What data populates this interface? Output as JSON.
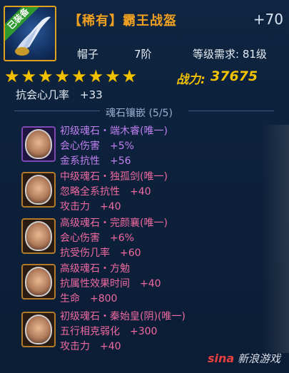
{
  "item": {
    "equipped_tag": "已装备",
    "name": "【稀有】霸王战盔",
    "enhance": "+70",
    "type": "帽子",
    "tier": "7阶",
    "level_req": "等级需求: 81级",
    "stars": 8,
    "power_label": "战力:",
    "power_value": "37675",
    "base_attr": "抗会心几率　+33"
  },
  "section_title": "魂石镶嵌 (5/5)",
  "gems": [
    {
      "name": "初级魂石・端木睿(唯一)",
      "name_color": "#c080f0",
      "frame": "purple",
      "attrs": [
        {
          "label": "会心伤害　+5%",
          "color": "#c080f0"
        },
        {
          "label": "金系抗性　+56",
          "color": "#c080f0"
        }
      ]
    },
    {
      "name": "中级魂石・独孤剑(唯一)",
      "name_color": "#f06aa0",
      "frame": "orange",
      "attrs": [
        {
          "label": "忽略全系抗性　+40",
          "color": "#f06aa0"
        },
        {
          "label": "攻击力　+40",
          "color": "#f06aa0"
        }
      ]
    },
    {
      "name": "高级魂石・完颜襄(唯一)",
      "name_color": "#f06aa0",
      "frame": "orange",
      "attrs": [
        {
          "label": "会心伤害　+6%",
          "color": "#f06aa0"
        },
        {
          "label": "抗受伤几率　+60",
          "color": "#f06aa0"
        }
      ]
    },
    {
      "name": "高级魂石・方勉",
      "name_color": "#f06aa0",
      "frame": "orange",
      "attrs": [
        {
          "label": "抗属性效果时间　+40",
          "color": "#f06aa0"
        },
        {
          "label": "生命　+800",
          "color": "#f06aa0"
        }
      ]
    },
    {
      "name": "初级魂石・秦始皇(阴)(唯一)",
      "name_color": "#f06aa0",
      "frame": "orange",
      "attrs": [
        {
          "label": "五行相克弱化　+300",
          "color": "#f06aa0"
        },
        {
          "label": "攻击力　+40",
          "color": "#f06aa0"
        }
      ]
    }
  ],
  "watermark": {
    "logo": "sina",
    "text": "新浪游戏"
  }
}
